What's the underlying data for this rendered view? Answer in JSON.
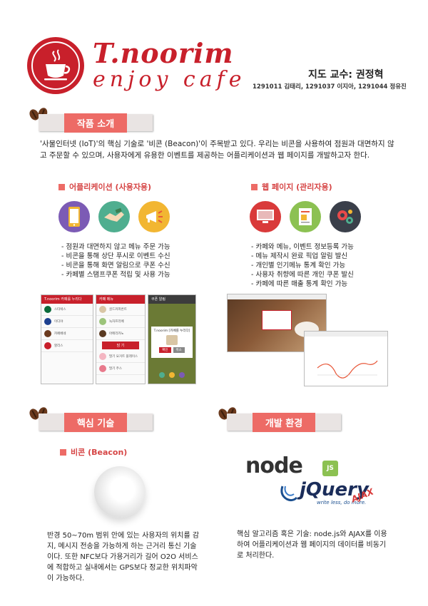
{
  "header": {
    "brand": "T.noorim",
    "tagline": "enjoy cafe",
    "professor": "지도 교수: 권정혁",
    "members": "1291011 김태리, 1291037 이지아, 1291044 정유진"
  },
  "intro": {
    "title": "작품 소개",
    "text": "'사물인터넷 (IoT)'의 핵심 기술로 '비콘 (Beacon)'이 주목받고 있다. 우리는 비콘을 사용하여 점원과 대면하지 않고 주문할 수 있으며, 사용자에게 유용한 이벤트를 제공하는 어플리케이션과 웹 페이지를 개발하고자 한다."
  },
  "app": {
    "title": "어플리케이션 (사용자용)",
    "icons": [
      "smartphone-icon",
      "handshake-icon",
      "megaphone-icon"
    ],
    "bullets": [
      "점원과 대면하지 않고 메뉴 주문 가능",
      "비콘을 통해 상단 푸시로 이벤트 수신",
      "비콘을 통해 화면 알림으로 쿠폰 수신",
      "카페별 스탬프쿠폰 적립 및 사용 가능"
    ],
    "screens": {
      "s1_title": "T.noorim 카페를 누리다",
      "s1_rows": [
        "스타벅스",
        "이디야",
        "카페베네",
        "할리스"
      ],
      "s2_title": "카페 메뉴",
      "s2_rows": [
        "골드커피번트",
        "녹차프라페",
        "아메리카노",
        "딸기 요거트 플레이스",
        "딸기 주스"
      ],
      "s2_button": "담 기",
      "s3_title": "쿠폰 알림",
      "s3_msg": "T.noorim [카페를 누리다]",
      "s3_btn_a": "확인",
      "s3_btn_b": "취소"
    }
  },
  "web": {
    "title": "웹 페이지 (관리자용)",
    "icons": [
      "monitor-icon",
      "document-icon",
      "gears-icon"
    ],
    "bullets": [
      "카페와 메뉴, 이벤트 정보등록 가능",
      "메뉴 제작시 완료 픽업 알림 발신",
      "개인별 인기메뉴 통계 확인 가능",
      "사용자 취향에 따른 개인 쿠폰 발신",
      "카페에 따른 매출 통계 확인 가능"
    ]
  },
  "tech": {
    "title": "핵심 기술",
    "sub": "비콘 (Beacon)",
    "text": "반경 50~70m 범위 안에 있는 사용자의 위치를 감지, 메시지 전송을 가능하게 하는 근거리 통신 기술이다. 또한 NFC보다 가용거리가 길어 O2O 서비스에 적합하고 실내에서는 GPS보다 정교한 위치파악이 가능하다."
  },
  "env": {
    "title": "개발 환경",
    "node_logo": "node",
    "node_badge": "JS",
    "jquery_logo": "jQuery",
    "jquery_slogan": "write less, do more.",
    "ajax": "AJAX",
    "text": "핵심 알고리즘 혹은 기술: node.js와 AJAX를 이용하여 어플리케이션과 웹 페이지의 데이터를 비동기로 처리한다."
  },
  "colors": {
    "accent": "#c8202b",
    "banner": "#ed6b66"
  }
}
